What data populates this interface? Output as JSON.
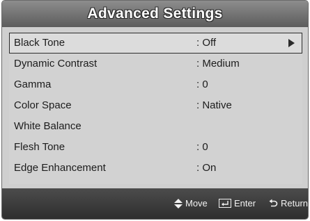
{
  "title": "Advanced Settings",
  "items": [
    {
      "label": "Black Tone",
      "value": ": Off",
      "selected": true
    },
    {
      "label": "Dynamic Contrast",
      "value": ": Medium"
    },
    {
      "label": "Gamma",
      "value": ": 0"
    },
    {
      "label": "Color Space",
      "value": ": Native"
    },
    {
      "label": "White Balance",
      "value": ""
    },
    {
      "label": "Flesh Tone",
      "value": ": 0"
    },
    {
      "label": "Edge Enhancement",
      "value": ": On"
    }
  ],
  "footer": {
    "move": "Move",
    "enter": "Enter",
    "return": "Return"
  },
  "icons": {
    "move": "up-down-arrows-icon",
    "enter": "enter-icon",
    "return": "return-icon"
  }
}
